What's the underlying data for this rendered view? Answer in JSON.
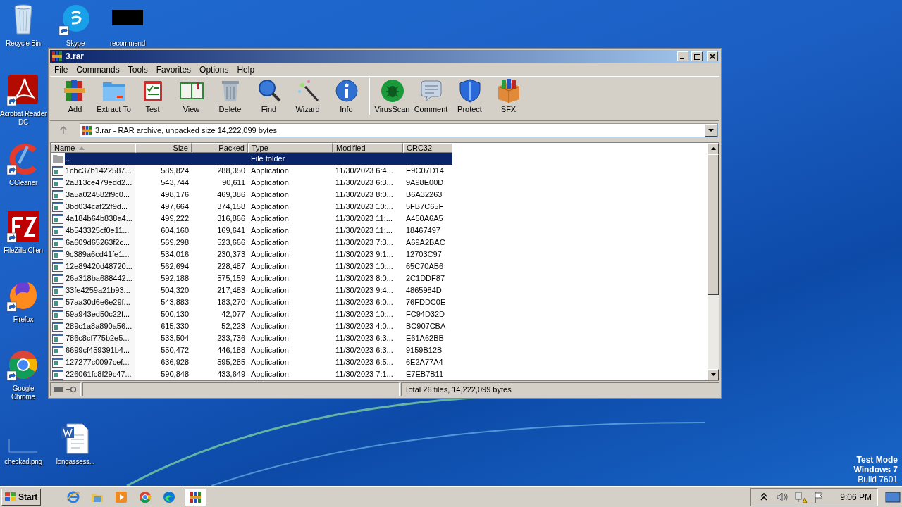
{
  "desktop": {
    "icons": [
      {
        "label": "Recycle Bin",
        "kind": "recycle",
        "shortcut": false
      },
      {
        "label": "Skype",
        "kind": "skype",
        "shortcut": true
      },
      {
        "label": "recommend",
        "kind": "blackbox",
        "shortcut": false
      },
      {
        "label": "Acrobat Reader DC",
        "kind": "acrobat",
        "shortcut": true
      },
      {
        "label": "CCleaner",
        "kind": "ccleaner",
        "shortcut": true
      },
      {
        "label": "FileZilla Clien",
        "kind": "filezilla",
        "shortcut": true
      },
      {
        "label": "Firefox",
        "kind": "firefox",
        "shortcut": true
      },
      {
        "label": "Google Chrome",
        "kind": "chrome",
        "shortcut": true
      },
      {
        "label": "checkad.png",
        "kind": "blank",
        "shortcut": false
      },
      {
        "label": "longassess...",
        "kind": "word",
        "shortcut": false
      }
    ],
    "os_notice": [
      "Test Mode",
      "Windows 7",
      "Build 7601"
    ]
  },
  "window": {
    "title": "3.rar",
    "menu": [
      "File",
      "Commands",
      "Tools",
      "Favorites",
      "Options",
      "Help"
    ],
    "toolbar": [
      {
        "label": "Add",
        "kind": "add"
      },
      {
        "label": "Extract To",
        "kind": "extract"
      },
      {
        "label": "Test",
        "kind": "test"
      },
      {
        "label": "View",
        "kind": "view"
      },
      {
        "label": "Delete",
        "kind": "delete"
      },
      {
        "label": "Find",
        "kind": "find"
      },
      {
        "label": "Wizard",
        "kind": "wizard"
      },
      {
        "label": "Info",
        "kind": "info"
      },
      {
        "label": "VirusScan",
        "kind": "virus"
      },
      {
        "label": "Comment",
        "kind": "comment"
      },
      {
        "label": "Protect",
        "kind": "protect"
      },
      {
        "label": "SFX",
        "kind": "sfx"
      }
    ],
    "address": "3.rar - RAR archive, unpacked size 14,222,099 bytes",
    "table": {
      "columns": [
        {
          "label": "Name",
          "sorted": true
        },
        {
          "label": "Size",
          "sorted": false
        },
        {
          "label": "Packed",
          "sorted": false
        },
        {
          "label": "Type",
          "sorted": false
        },
        {
          "label": "Modified",
          "sorted": false
        },
        {
          "label": "CRC32",
          "sorted": false
        }
      ],
      "rows": [
        {
          "kind": "folder",
          "name": "..",
          "size": "",
          "packed": "",
          "type": "File folder",
          "modified": "",
          "crc": "",
          "selected": true
        },
        {
          "kind": "file",
          "name": "1cbc37b1422587...",
          "size": "589,824",
          "packed": "288,350",
          "type": "Application",
          "modified": "11/30/2023 6:4...",
          "crc": "E9C07D14",
          "selected": false
        },
        {
          "kind": "file",
          "name": "2a313ce479edd2...",
          "size": "543,744",
          "packed": "90,611",
          "type": "Application",
          "modified": "11/30/2023 6:3...",
          "crc": "9A98E00D",
          "selected": false
        },
        {
          "kind": "file",
          "name": "3a5a024582f9c0...",
          "size": "498,176",
          "packed": "469,386",
          "type": "Application",
          "modified": "11/30/2023 8:0...",
          "crc": "B6A32263",
          "selected": false
        },
        {
          "kind": "file",
          "name": "3bd034caf22f9d...",
          "size": "497,664",
          "packed": "374,158",
          "type": "Application",
          "modified": "11/30/2023 10:...",
          "crc": "5FB7C65F",
          "selected": false
        },
        {
          "kind": "file",
          "name": "4a184b64b838a4...",
          "size": "499,222",
          "packed": "316,866",
          "type": "Application",
          "modified": "11/30/2023 11:...",
          "crc": "A450A6A5",
          "selected": false
        },
        {
          "kind": "file",
          "name": "4b543325cf0e11...",
          "size": "604,160",
          "packed": "169,641",
          "type": "Application",
          "modified": "11/30/2023 11:...",
          "crc": "18467497",
          "selected": false
        },
        {
          "kind": "file",
          "name": "6a609d65263f2c...",
          "size": "569,298",
          "packed": "523,666",
          "type": "Application",
          "modified": "11/30/2023 7:3...",
          "crc": "A69A2BAC",
          "selected": false
        },
        {
          "kind": "file",
          "name": "9c389a6cd41fe1...",
          "size": "534,016",
          "packed": "230,373",
          "type": "Application",
          "modified": "11/30/2023 9:1...",
          "crc": "12703C97",
          "selected": false
        },
        {
          "kind": "file",
          "name": "12e89420d48720...",
          "size": "562,694",
          "packed": "228,487",
          "type": "Application",
          "modified": "11/30/2023 10:...",
          "crc": "65C70AB6",
          "selected": false
        },
        {
          "kind": "file",
          "name": "26a318ba688442...",
          "size": "592,188",
          "packed": "575,159",
          "type": "Application",
          "modified": "11/30/2023 8:0...",
          "crc": "2C1DDF87",
          "selected": false
        },
        {
          "kind": "file",
          "name": "33fe4259a21b93...",
          "size": "504,320",
          "packed": "217,483",
          "type": "Application",
          "modified": "11/30/2023 9:4...",
          "crc": "4865984D",
          "selected": false
        },
        {
          "kind": "file",
          "name": "57aa30d6e6e29f...",
          "size": "543,883",
          "packed": "183,270",
          "type": "Application",
          "modified": "11/30/2023 6:0...",
          "crc": "76FDDC0E",
          "selected": false
        },
        {
          "kind": "file",
          "name": "59a943ed50c22f...",
          "size": "500,130",
          "packed": "42,077",
          "type": "Application",
          "modified": "11/30/2023 10:...",
          "crc": "FC94D32D",
          "selected": false
        },
        {
          "kind": "file",
          "name": "289c1a8a890a56...",
          "size": "615,330",
          "packed": "52,223",
          "type": "Application",
          "modified": "11/30/2023 4:0...",
          "crc": "BC907CBA",
          "selected": false
        },
        {
          "kind": "file",
          "name": "786c8cf775b2e5...",
          "size": "533,504",
          "packed": "233,736",
          "type": "Application",
          "modified": "11/30/2023 6:3...",
          "crc": "E61A62BB",
          "selected": false
        },
        {
          "kind": "file",
          "name": "6699cf459391b4...",
          "size": "550,472",
          "packed": "446,188",
          "type": "Application",
          "modified": "11/30/2023 6:3...",
          "crc": "9159B12B",
          "selected": false
        },
        {
          "kind": "file",
          "name": "127277c0097cef...",
          "size": "636,928",
          "packed": "595,285",
          "type": "Application",
          "modified": "11/30/2023 6:5...",
          "crc": "6E2A77A4",
          "selected": false
        },
        {
          "kind": "file",
          "name": "226061fc8f29c47...",
          "size": "590,848",
          "packed": "433,649",
          "type": "Application",
          "modified": "11/30/2023 7:1...",
          "crc": "E7EB7B11",
          "selected": false
        }
      ]
    },
    "status_bar": "Total 26 files, 14,222,099 bytes"
  },
  "taskbar": {
    "start": "Start",
    "apps": [
      {
        "kind": "ie",
        "selected": false
      },
      {
        "kind": "explorer",
        "selected": false
      },
      {
        "kind": "media",
        "selected": false
      },
      {
        "kind": "chrome",
        "selected": false
      },
      {
        "kind": "edge",
        "selected": false
      },
      {
        "kind": "winrar",
        "selected": true
      }
    ],
    "tray": [
      {
        "kind": "up"
      },
      {
        "kind": "speaker"
      },
      {
        "kind": "network"
      },
      {
        "kind": "flag"
      }
    ],
    "time": "9:06 PM"
  }
}
